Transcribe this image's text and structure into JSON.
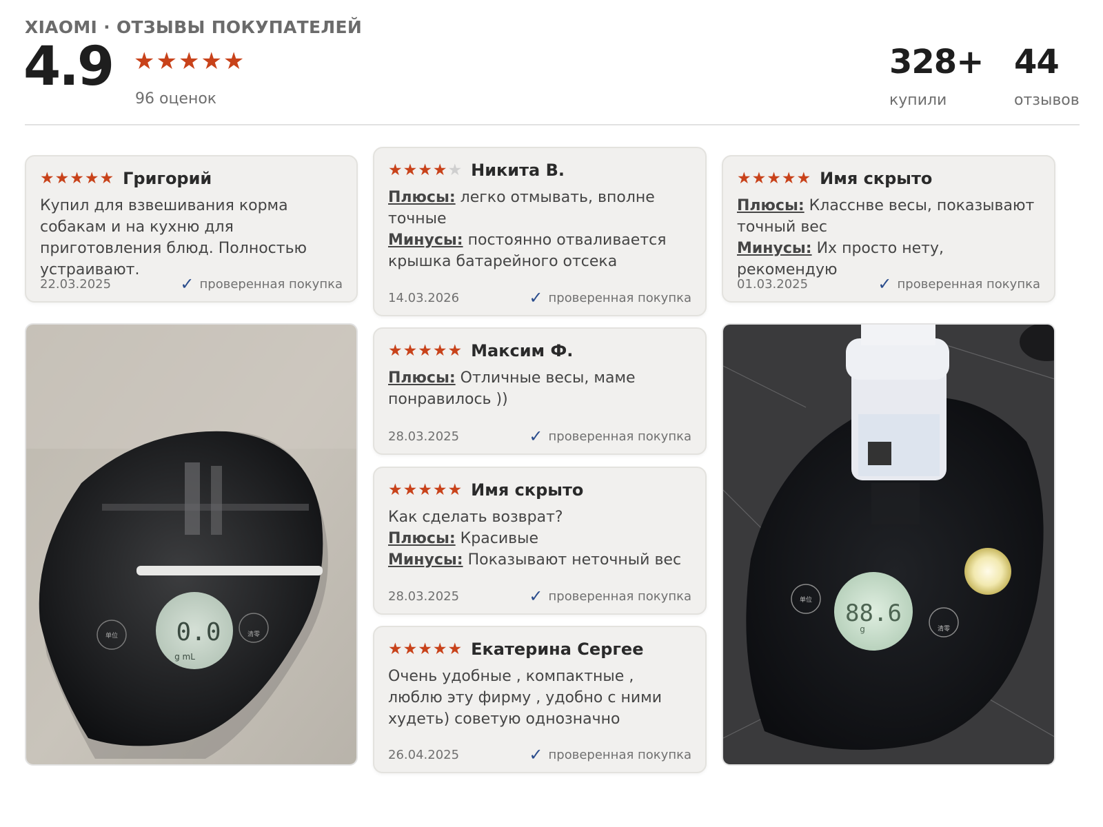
{
  "header": {
    "brand": "XIAOMI · ОТЗЫВЫ ПОКУПАТЕЛЕЙ",
    "score": "4.9",
    "stars": "★★★★★",
    "ratings_count": "96 оценок",
    "bought_value": "328+",
    "bought_label": "купили",
    "reviews_value": "44",
    "reviews_label": "отзывов"
  },
  "labels": {
    "plus": "Плюсы:",
    "minus": "Минусы:",
    "verified": "проверенная покупка"
  },
  "reviews": [
    {
      "rating": 5,
      "stars_on": "★★★★★",
      "stars_off": "",
      "author": "Григорий",
      "text": "Купил для взвешивания корма собакам и на кухню для приготовления блюд. Полностью устраивают.",
      "date": "22.03.2025"
    },
    {
      "rating": 4,
      "stars_on": "★★★★",
      "stars_off": "★",
      "author": "Никита В.",
      "plus": "легко отмывать, вполне точные",
      "minus": "постоянно отваливается крышка батарейного отсека",
      "date": "14.03.2026"
    },
    {
      "rating": 5,
      "stars_on": "★★★★★",
      "stars_off": "",
      "author": "Имя скрыто",
      "plus": "Класснве весы, показывают точный вес",
      "minus": "Их просто нету, рекомендую",
      "date": "01.03.2025"
    },
    {
      "rating": 5,
      "stars_on": "★★★★★",
      "stars_off": "",
      "author": "Максим Ф.",
      "plus": "Отличные весы, маме понравилось ))",
      "date": "28.03.2025"
    },
    {
      "rating": 5,
      "stars_on": "★★★★★",
      "stars_off": "",
      "author": "Имя скрыто",
      "text": "Как сделать возврат?",
      "plus": "Красивые",
      "minus": "Показывают неточный вес",
      "date": "28.03.2025"
    },
    {
      "rating": 5,
      "stars_on": "★★★★★",
      "stars_off": "",
      "author": "Екатерина Сергее",
      "text": "Очень удобные , компактные , люблю эту фирму , удобно с ними худеть) советую однозначно",
      "date": "26.04.2025"
    }
  ],
  "photos": {
    "left": {
      "display": "0.0",
      "unit": "g mL",
      "btn_unit": "单位",
      "btn_zero": "清零"
    },
    "right": {
      "display": "88.6",
      "unit": "g",
      "btn_unit": "单位",
      "btn_zero": "清零"
    }
  },
  "colors": {
    "star": "#c8421a",
    "star_off": "#cfcfcf",
    "check": "#2a4c8c",
    "card_bg": "#f1f0ee"
  }
}
